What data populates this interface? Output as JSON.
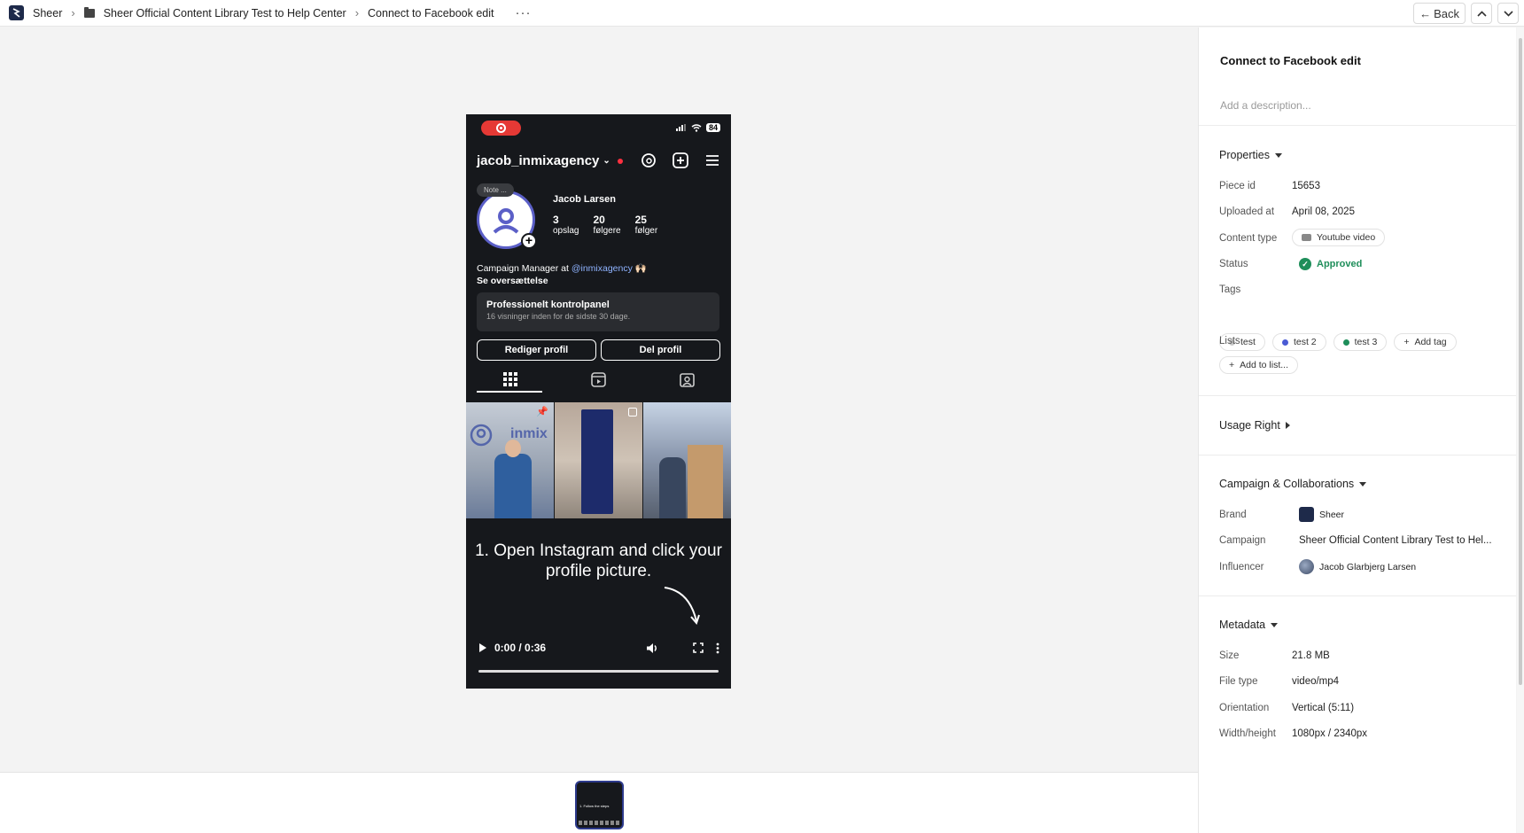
{
  "breadcrumb": {
    "app": "Sheer",
    "folder": "Sheer Official Content Library Test to Help Center",
    "current": "Connect to Facebook edit",
    "more": "···"
  },
  "nav": {
    "back_label": "Back",
    "up_icon": "chevron-up-icon",
    "down_icon": "chevron-down-icon"
  },
  "video": {
    "caption": "1. Open Instagram and click your profile picture.",
    "time": "0:00 / 0:36",
    "progress": 0,
    "phone": {
      "battery": "84",
      "username": "jacob_inmixagency",
      "note": "Note ...",
      "name": "Jacob Larsen",
      "stats": [
        {
          "value": "3",
          "label": "opslag"
        },
        {
          "value": "20",
          "label": "følgere"
        },
        {
          "value": "25",
          "label": "følger"
        }
      ],
      "bio_prefix": "Campaign Manager at",
      "bio_mention": "@inmixagency",
      "bio_emoji": "🙌🏻",
      "bio_translate": "Se oversættelse",
      "pro_title": "Professionelt kontrolpanel",
      "pro_sub": "16 visninger inden for de sidste 30 dage.",
      "edit_profile": "Rediger profil",
      "share_profile": "Del profil",
      "grid_logo": "inmix"
    }
  },
  "thumbnail": {
    "text": "1. Follow the steps"
  },
  "panel": {
    "title": "Connect to Facebook edit",
    "description_placeholder": "Add a description...",
    "properties": {
      "heading": "Properties",
      "piece_id_label": "Piece id",
      "piece_id": "15653",
      "uploaded_label": "Uploaded at",
      "uploaded": "April 08, 2025",
      "content_type_label": "Content type",
      "content_type": "Youtube video",
      "status_label": "Status",
      "status": "Approved",
      "status_color": "#1e8e5a",
      "tags_label": "Tags",
      "tags": [
        {
          "name": "test",
          "color": "#c8c8c8"
        },
        {
          "name": "test 2",
          "color": "#4a5bd4"
        },
        {
          "name": "test 3",
          "color": "#1e8e5a"
        }
      ],
      "add_tag": "Add tag",
      "lists_label": "Lists",
      "add_to_list": "Add to list..."
    },
    "usage_right": {
      "heading": "Usage Right"
    },
    "campaign": {
      "heading": "Campaign & Collaborations",
      "brand_label": "Brand",
      "brand": "Sheer",
      "campaign_label": "Campaign",
      "campaign": "Sheer Official Content Library Test to Hel...",
      "influencer_label": "Influencer",
      "influencer": "Jacob Glarbjerg Larsen"
    },
    "metadata": {
      "heading": "Metadata",
      "size_label": "Size",
      "size": "21.8 MB",
      "file_type_label": "File type",
      "file_type": "video/mp4",
      "orientation_label": "Orientation",
      "orientation": "Vertical (5:11)",
      "wh_label": "Width/height",
      "wh": "1080px / 2340px"
    }
  }
}
